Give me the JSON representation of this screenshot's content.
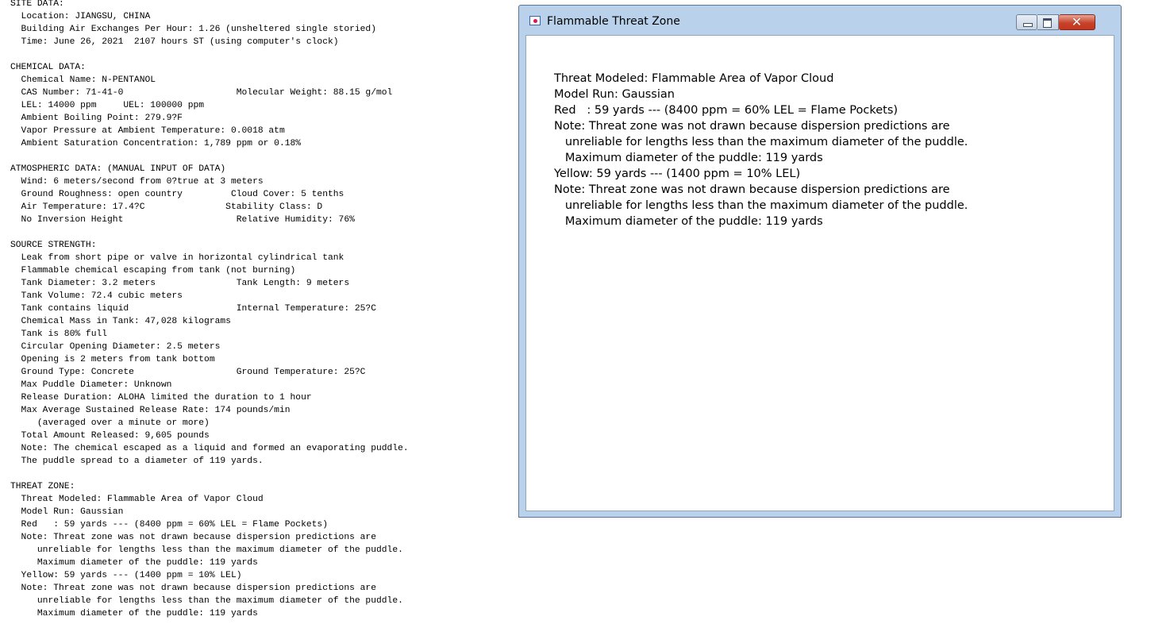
{
  "report": {
    "lines": [
      "SITE DATA:",
      "  Location: JIANGSU, CHINA",
      "  Building Air Exchanges Per Hour: 1.26 (unsheltered single storied)",
      "  Time: June 26, 2021  2107 hours ST (using computer's clock)",
      "",
      "CHEMICAL DATA:",
      "  Chemical Name: N-PENTANOL",
      "  CAS Number: 71-41-0                     Molecular Weight: 88.15 g/mol",
      "  LEL: 14000 ppm     UEL: 100000 ppm",
      "  Ambient Boiling Point: 279.9?F",
      "  Vapor Pressure at Ambient Temperature: 0.0018 atm",
      "  Ambient Saturation Concentration: 1,789 ppm or 0.18%",
      "",
      "ATMOSPHERIC DATA: (MANUAL INPUT OF DATA)",
      "  Wind: 6 meters/second from 0?true at 3 meters",
      "  Ground Roughness: open country         Cloud Cover: 5 tenths",
      "  Air Temperature: 17.4?C               Stability Class: D",
      "  No Inversion Height                     Relative Humidity: 76%",
      "",
      "SOURCE STRENGTH:",
      "  Leak from short pipe or valve in horizontal cylindrical tank",
      "  Flammable chemical escaping from tank (not burning)",
      "  Tank Diameter: 3.2 meters               Tank Length: 9 meters",
      "  Tank Volume: 72.4 cubic meters",
      "  Tank contains liquid                    Internal Temperature: 25?C",
      "  Chemical Mass in Tank: 47,028 kilograms",
      "  Tank is 80% full",
      "  Circular Opening Diameter: 2.5 meters",
      "  Opening is 2 meters from tank bottom",
      "  Ground Type: Concrete                   Ground Temperature: 25?C",
      "  Max Puddle Diameter: Unknown",
      "  Release Duration: ALOHA limited the duration to 1 hour",
      "  Max Average Sustained Release Rate: 174 pounds/min",
      "     (averaged over a minute or more)",
      "  Total Amount Released: 9,605 pounds",
      "  Note: The chemical escaped as a liquid and formed an evaporating puddle.",
      "  The puddle spread to a diameter of 119 yards.",
      "",
      "THREAT ZONE:",
      "  Threat Modeled: Flammable Area of Vapor Cloud",
      "  Model Run: Gaussian",
      "  Red   : 59 yards --- (8400 ppm = 60% LEL = Flame Pockets)",
      "  Note: Threat zone was not drawn because dispersion predictions are",
      "     unreliable for lengths less than the maximum diameter of the puddle.",
      "     Maximum diameter of the puddle: 119 yards",
      "  Yellow: 59 yards --- (1400 ppm = 10% LEL)",
      "  Note: Threat zone was not drawn because dispersion predictions are",
      "     unreliable for lengths less than the maximum diameter of the puddle.",
      "     Maximum diameter of the puddle: 119 yards"
    ]
  },
  "window": {
    "title": "Flammable Threat Zone",
    "app_icon": "aloha-app-icon",
    "controls": {
      "minimize_icon": "minimize-icon",
      "maximize_icon": "maximize-icon",
      "close_icon": "close-icon",
      "close_glyph": "✕",
      "close_color": "#c7341d"
    },
    "lines": [
      "Threat Modeled: Flammable Area of Vapor Cloud",
      "Model Run: Gaussian",
      "Red   : 59 yards --- (8400 ppm = 60% LEL = Flame Pockets)",
      "Note: Threat zone was not drawn because dispersion predictions are",
      "   unreliable for lengths less than the maximum diameter of the puddle.",
      "   Maximum diameter of the puddle: 119 yards",
      "Yellow: 59 yards --- (1400 ppm = 10% LEL)",
      "Note: Threat zone was not drawn because dispersion predictions are",
      "   unreliable for lengths less than the maximum diameter of the puddle.",
      "   Maximum diameter of the puddle: 119 yards"
    ]
  }
}
